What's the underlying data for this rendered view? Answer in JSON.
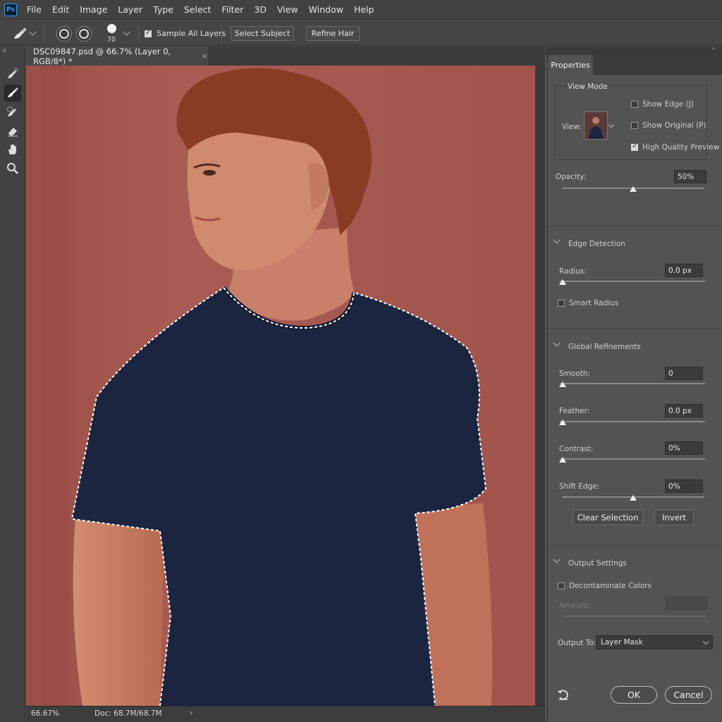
{
  "app": {
    "logo_text": "Ps"
  },
  "menu": [
    "File",
    "Edit",
    "Image",
    "Layer",
    "Type",
    "Select",
    "Filter",
    "3D",
    "View",
    "Window",
    "Help"
  ],
  "options_bar": {
    "brush_size": "70",
    "sample_all_layers_label": "Sample All Layers",
    "sample_all_layers_checked": true,
    "select_subject_label": "Select Subject",
    "refine_hair_label": "Refine Hair"
  },
  "document": {
    "tab_title": "DSC09847.psd @ 66.7% (Layer 0, RGB/8*) *",
    "close_glyph": "×"
  },
  "status_bar": {
    "zoom": "66.67%",
    "doc_size": "Doc: 68.7M/68.7M",
    "arrow": "›"
  },
  "properties": {
    "tab_label": "Properties",
    "view_mode": {
      "title": "View Mode",
      "view_label": "View:",
      "show_edge": {
        "label": "Show Edge (J)",
        "checked": false
      },
      "show_original": {
        "label": "Show Original (P)",
        "checked": false
      },
      "high_quality_preview": {
        "label": "High Quality Preview",
        "checked": true
      }
    },
    "opacity": {
      "label": "Opacity:",
      "value": "50%",
      "level": 0.5
    },
    "edge_detection": {
      "title": "Edge Detection",
      "radius": {
        "label": "Radius:",
        "value": "0.0 px",
        "level": 0
      },
      "smart_radius": {
        "label": "Smart Radius",
        "checked": false
      }
    },
    "global_refinements": {
      "title": "Global Refinements",
      "smooth": {
        "label": "Smooth:",
        "value": "0",
        "level": 0
      },
      "feather": {
        "label": "Feather:",
        "value": "0.0 px",
        "level": 0
      },
      "contrast": {
        "label": "Contrast:",
        "value": "0%",
        "level": 0
      },
      "shift_edge": {
        "label": "Shift Edge:",
        "value": "0%",
        "level": 0.5
      },
      "clear_selection_label": "Clear Selection",
      "invert_label": "Invert"
    },
    "output_settings": {
      "title": "Output Settings",
      "decontaminate": {
        "label": "Decontaminate Colors",
        "checked": false
      },
      "amount_label": "Amount:",
      "output_to_label": "Output To:",
      "output_to_value": "Layer Mask"
    },
    "ok_label": "OK",
    "cancel_label": "Cancel"
  },
  "colors": {
    "background_wall": "#a55850",
    "shirt": "#1c2540",
    "skin": "#c77b62",
    "hair": "#8a3b24"
  }
}
